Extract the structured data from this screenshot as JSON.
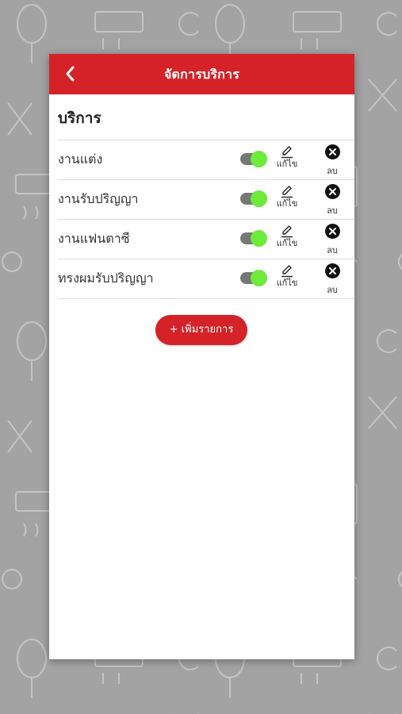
{
  "header": {
    "title": "จัดการบริการ",
    "back_icon": "chevron-left-icon"
  },
  "section": {
    "title": "บริการ"
  },
  "services": [
    {
      "name": "งานแต่ง",
      "enabled": true
    },
    {
      "name": "งานรับปริญญา",
      "enabled": true
    },
    {
      "name": "งานแฟนตาซี",
      "enabled": true
    },
    {
      "name": "ทรงผมรับปริญญา",
      "enabled": true
    }
  ],
  "actions": {
    "edit_label": "แก้ไข",
    "delete_label": "ลบ",
    "edit_icon": "pencil-icon",
    "delete_icon": "close-circle-icon"
  },
  "add_button": {
    "label": "+ เพิ่มรายการ"
  },
  "colors": {
    "brand_red": "#d42228",
    "toggle_on": "#6dea3a",
    "background": "#a3a3a3"
  }
}
